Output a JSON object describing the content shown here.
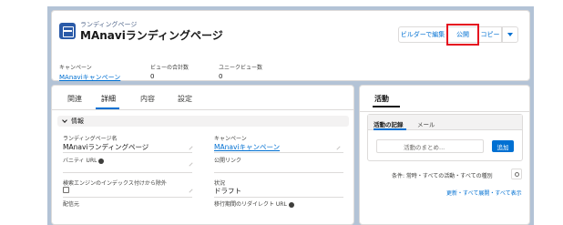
{
  "header": {
    "object_type": "ランディングページ",
    "record_title": "MAnaviランディングページ",
    "buttons": {
      "builder": "ビルダーで編集",
      "publish": "公開",
      "copy": "コピー"
    }
  },
  "highlights": [
    {
      "label": "キャンペーン",
      "value": "MAnaviキャンペーン"
    },
    {
      "label": "ビューの合計数",
      "value": "0"
    },
    {
      "label": "ユニークビュー数",
      "value": "0"
    }
  ],
  "tabs": [
    "関連",
    "詳細",
    "内容",
    "設定"
  ],
  "details": {
    "section_title": "情報",
    "fields": {
      "name_label": "ランディングページ名",
      "name_value": "MAnaviランディングページ",
      "vanity_label": "バニティ URL",
      "campaign_label": "キャンペーン",
      "campaign_value": "MAnaviキャンペーン",
      "public_link_label": "公開リンク",
      "exclude_label": "検索エンジンのインデックス付けから除外",
      "status_label": "状況",
      "status_value": "ドラフト",
      "bottom_left_label": "配信元",
      "bottom_right_label": "移行期間のリダイレクト URL"
    }
  },
  "activity": {
    "title": "活動",
    "tabs": [
      "活動の記録",
      "メール"
    ],
    "input_placeholder": "活動のまとめ...",
    "add_button": "追加",
    "filter_text": "条件: 常時・すべての活動・すべての種別",
    "refresh_text": "更新・すべて展開・すべて表示"
  },
  "colors": {
    "brand_blue": "#0070d2",
    "highlight_red": "#e5101f",
    "page_backdrop": "#b3c3d6"
  }
}
